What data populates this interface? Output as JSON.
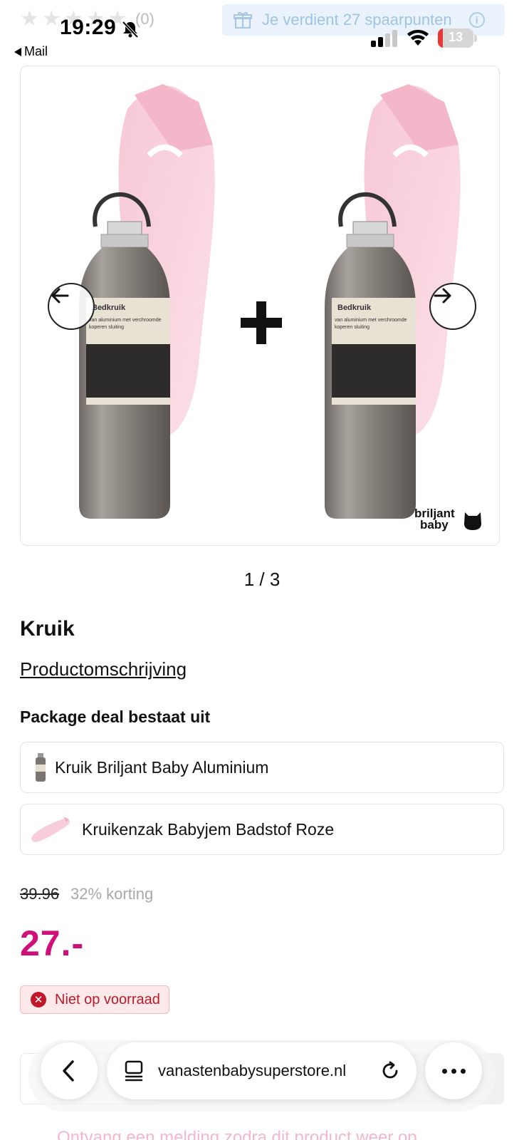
{
  "status_bar": {
    "time": "19:29",
    "back_label": "Mail",
    "battery_percent": "13"
  },
  "page_header": {
    "rating_count": "(0)",
    "rating_stars": 0,
    "points_banner": "Je verdient 27 spaarpunten"
  },
  "gallery": {
    "pager": "1 / 3",
    "image_label_1": "Bedkruik",
    "image_label_2": "van aluminium met verchroomde",
    "image_label_3": "koperen sluiting",
    "brand_logo_line1": "briljant",
    "brand_logo_line2": "baby"
  },
  "product": {
    "title": "Kruik",
    "description_link": "Productomschrijving",
    "package_heading": "Package deal bestaat uit",
    "package_items": [
      {
        "label": "Kruik Briljant Baby Aluminium"
      },
      {
        "label": "Kruikenzak Babyjem Badstof Roze"
      }
    ],
    "old_price": "39.96",
    "discount": "32% korting",
    "price": "27.-",
    "stock_status": "Niet op voorraad",
    "notify_text": "Ontvang een melding zodra dit product weer op"
  },
  "browser": {
    "url": "vanastenbabysuperstore.nl"
  },
  "colors": {
    "price": "#cf1078",
    "stock_bg": "#fde8ea",
    "stock_text": "#b71c2b",
    "banner_bg": "#eaf3fb"
  }
}
